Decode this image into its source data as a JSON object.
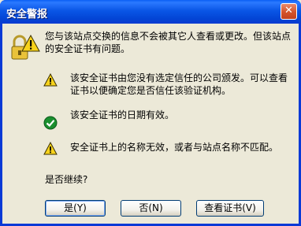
{
  "window": {
    "title": "安全警报",
    "close_symbol": "✕"
  },
  "main_message": {
    "line1": "您与该站点交换的信息不会被其它人查看或更改。但该站点",
    "line2": "的安全证书有问题。"
  },
  "items": [
    {
      "icon": "warning-icon",
      "line1": "该安全证书由您没有选定信任的公司颁发。可以查看",
      "line2": "证书以便确定您是否信任该验证机构。"
    },
    {
      "icon": "check-icon",
      "line1": "该安全证书的日期有效。"
    },
    {
      "icon": "warning-icon",
      "line1": "安全证书上的名称无效，或者与站点名称不匹配。"
    }
  ],
  "question": "是否继续?",
  "buttons": {
    "yes": "是(Y)",
    "no": "否(N)",
    "view_cert": "查看证书(V)"
  },
  "colors": {
    "titlebar": "#0a5ae8",
    "dialog_bg": "#ece9d8",
    "warning_yellow": "#f7d21b",
    "check_green": "#1a8f2e",
    "close_button": "#d4532b"
  }
}
